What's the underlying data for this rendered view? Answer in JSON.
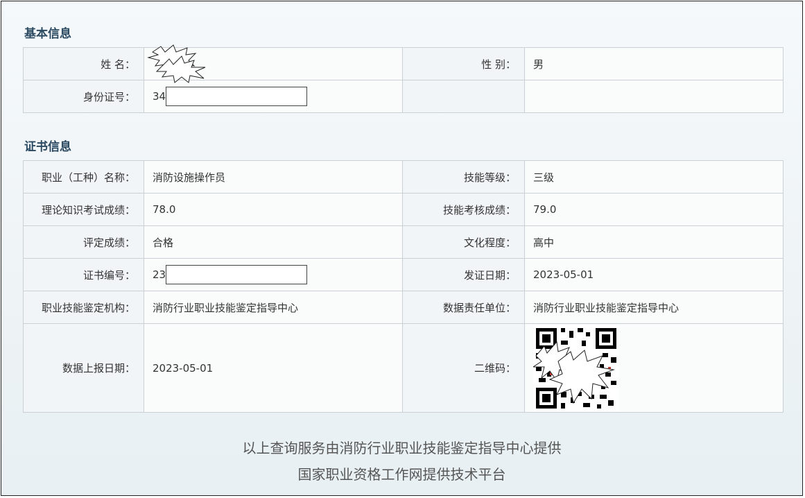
{
  "basic": {
    "title": "基本信息",
    "name_label": "姓 名",
    "gender_label": "性 别",
    "gender_value": "男",
    "id_label": "身份证号",
    "id_prefix": "34"
  },
  "cert": {
    "title": "证书信息",
    "rows": [
      {
        "l1": "职业（工种）名称",
        "v1": "消防设施操作员",
        "l2": "技能等级",
        "v2": "三级"
      },
      {
        "l1": "理论知识考试成绩",
        "v1": "78.0",
        "l2": "技能考核成绩",
        "v2": "79.0"
      },
      {
        "l1": "评定成绩",
        "v1": "合格",
        "l2": "文化程度",
        "v2": "高中"
      },
      {
        "l1": "证书编号",
        "v1": "23",
        "l2": "发证日期",
        "v2": "2023-05-01"
      },
      {
        "l1": "职业技能鉴定机构",
        "v1": "消防行业职业技能鉴定指导中心",
        "l2": "数据责任单位",
        "v2": "消防行业职业技能鉴定指导中心"
      },
      {
        "l1": "数据上报日期",
        "v1": "2023-05-01",
        "l2": "二维码",
        "v2": ""
      }
    ]
  },
  "colon": "：",
  "footer": {
    "line1": "以上查询服务由消防行业职业技能鉴定指导中心提供",
    "line2": "国家职业资格工作网提供技术平台"
  }
}
